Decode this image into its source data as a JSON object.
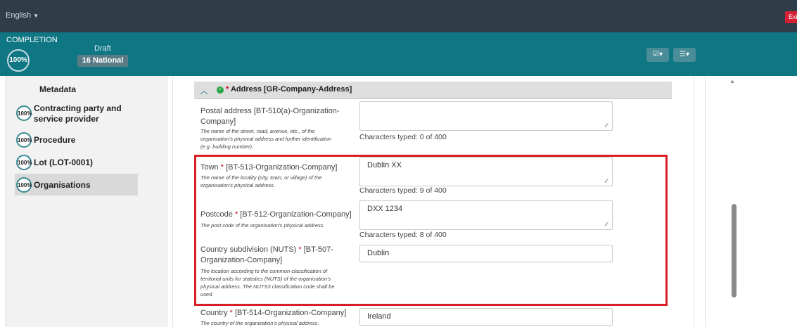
{
  "topbar": {
    "language": "English",
    "exit_label": "Exit"
  },
  "completion": {
    "label": "COMPLETION",
    "percent": "100%",
    "status": "Draft",
    "notice_type": "16 National"
  },
  "toolbar": {
    "validate_icon": "checklist-icon",
    "settings_icon": "sliders-icon"
  },
  "sidebar": {
    "items": [
      {
        "label": "Metadata"
      },
      {
        "percent": "100%",
        "label_line1": "Contracting party and",
        "label_line2": "service provider"
      },
      {
        "percent": "100%",
        "label": "Procedure"
      },
      {
        "percent": "100%",
        "label": "Lot (LOT-0001)"
      },
      {
        "percent": "100%",
        "label": "Organisations"
      }
    ]
  },
  "section": {
    "star": "*",
    "title": "Address  [GR-Company-Address]"
  },
  "fields": {
    "postal": {
      "label_line1": "Postal address [BT-510(a)-Organization-",
      "label_line2": "Company]",
      "help_line1": "The name of the street, road, avenue, etc., of the",
      "help_line2": "organisation's physical address and further identification",
      "help_line3": "(e.g. building number).",
      "value": "",
      "count": "Characters typed: 0 of 400"
    },
    "town": {
      "label": "Town",
      "star": "*",
      "label_code": "[BT-513-Organization-Company]",
      "help_line1": "The name of the locality (city, town, or village) of the",
      "help_line2": "organisation's physical address.",
      "value": "Dublin XX",
      "count": "Characters typed: 9 of 400"
    },
    "postcode": {
      "label": "Postcode",
      "star": "*",
      "label_code": "[BT-512-Organization-Company]",
      "help": "The post code of the organisation's physical address.",
      "value": "DXX 1234",
      "count": "Characters typed: 8 of 400"
    },
    "nuts": {
      "label": "Country subdivision (NUTS)",
      "star": "*",
      "label_code": "[BT-507-",
      "label_line2": "Organization-Company]",
      "help_line1": "The location according to the common classification of",
      "help_line2": "territorial units for statistics (NUTS) of the organisation's",
      "help_line3": "physical address. The NUTS3 classification code shall be",
      "help_line4": "used.",
      "value": "Dublin"
    },
    "country": {
      "label": "Country",
      "star": "*",
      "label_code": "[BT-514-Organization-Company]",
      "help": "The country of the organization's physical address.",
      "value": "Ireland"
    }
  },
  "colors": {
    "topbar": "#2e3d48",
    "completion": "#0f7684",
    "highlight": "#d81f26",
    "required": "#d0021b"
  }
}
